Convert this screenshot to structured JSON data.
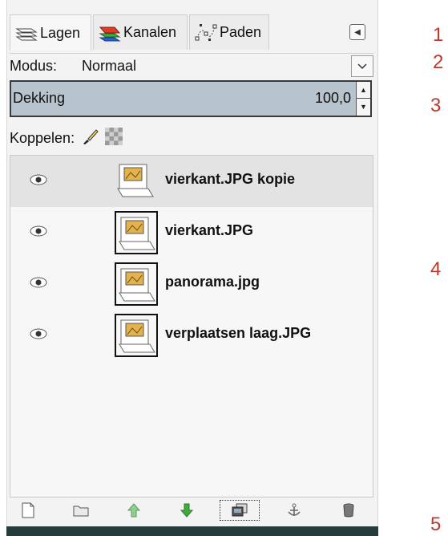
{
  "tabs": [
    {
      "label": "Lagen",
      "icon": "layers-icon"
    },
    {
      "label": "Kanalen",
      "icon": "channels-icon"
    },
    {
      "label": "Paden",
      "icon": "paths-icon"
    }
  ],
  "modus": {
    "label": "Modus:",
    "value": "Normaal"
  },
  "opacity": {
    "label": "Dekking",
    "value": "100,0"
  },
  "koppelen": {
    "label": "Koppelen:"
  },
  "layers": [
    {
      "name": "vierkant.JPG kopie",
      "selected": true
    },
    {
      "name": "vierkant.JPG",
      "selected": false
    },
    {
      "name": "panorama.jpg",
      "selected": false
    },
    {
      "name": "verplaatsen laag.JPG",
      "selected": false
    }
  ],
  "toolbar": [
    "new-layer-icon",
    "new-layer-group-icon",
    "raise-layer-icon",
    "lower-layer-icon",
    "duplicate-layer-icon",
    "anchor-layer-icon",
    "delete-layer-icon"
  ],
  "annotations": [
    "1",
    "2",
    "3",
    "4",
    "5"
  ],
  "colors": {
    "accent": "#c0392b",
    "slider": "#b7c4cd",
    "selected": "#e3e3e3"
  }
}
